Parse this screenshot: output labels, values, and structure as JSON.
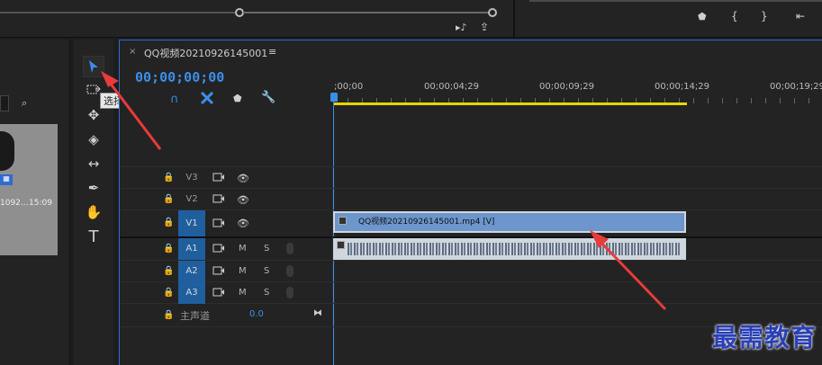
{
  "sequence_tab": {
    "title": "QQ视频20210926145001"
  },
  "timecode": "00;00;00;00",
  "ruler_labels": [
    ";00;00",
    "00;00;04;29",
    "00;00;09;29",
    "00;00;14;29",
    "00;00;19;29"
  ],
  "tooltip": "选择工具 (V)",
  "project_item": {
    "name": "1092...",
    "duration": "15:09"
  },
  "video_tracks": [
    {
      "name": "V3",
      "active": false
    },
    {
      "name": "V2",
      "active": false
    },
    {
      "name": "V1",
      "active": true
    }
  ],
  "audio_tracks": [
    {
      "name": "A1",
      "m": "M",
      "s": "S"
    },
    {
      "name": "A2",
      "m": "M",
      "s": "S"
    },
    {
      "name": "A3",
      "m": "M",
      "s": "S"
    }
  ],
  "master": {
    "label": "主声道",
    "value": "0.0"
  },
  "clip": {
    "label": "QQ视频20210926145001.mp4 [V]"
  },
  "watermark": "最需教育",
  "colors": {
    "accent_blue": "#3b8ee8",
    "clip_video": "#6c96cc",
    "clip_audio": "#cfd6de",
    "playhead_bar": "#e6d600",
    "arrow": "#e83b3b"
  }
}
